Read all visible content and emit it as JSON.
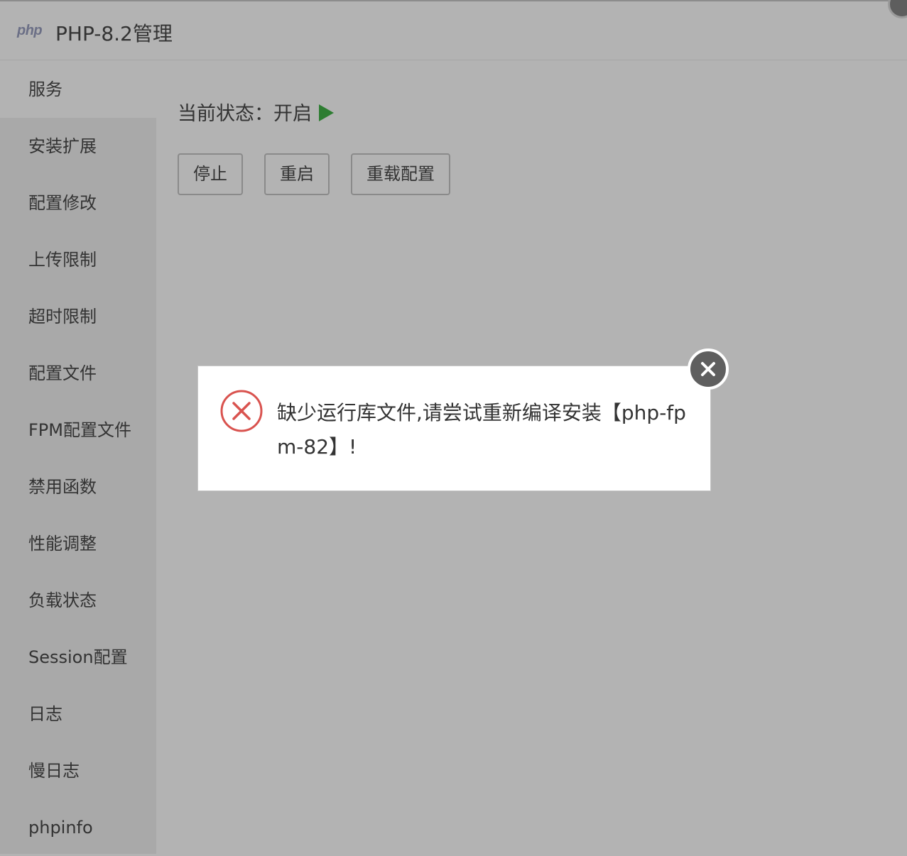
{
  "window": {
    "logo": "php",
    "title": "PHP-8.2管理"
  },
  "sidebar": {
    "items": [
      {
        "label": "服务",
        "active": true
      },
      {
        "label": "安装扩展"
      },
      {
        "label": "配置修改"
      },
      {
        "label": "上传限制"
      },
      {
        "label": "超时限制"
      },
      {
        "label": "配置文件"
      },
      {
        "label": "FPM配置文件"
      },
      {
        "label": "禁用函数"
      },
      {
        "label": "性能调整"
      },
      {
        "label": "负载状态"
      },
      {
        "label": "Session配置"
      },
      {
        "label": "日志"
      },
      {
        "label": "慢日志"
      },
      {
        "label": "phpinfo"
      }
    ]
  },
  "main": {
    "status_text": "当前状态：开启",
    "status_icon": "play-icon",
    "status_color": "#2e7d32",
    "buttons": {
      "stop": "停止",
      "restart": "重启",
      "reload": "重载配置"
    }
  },
  "dialog": {
    "icon": "error-icon",
    "message": "缺少运行库文件,请尝试重新编译安装【php-fpm-82】!",
    "close_icon": "close-icon",
    "accent_color": "#d9534f"
  }
}
